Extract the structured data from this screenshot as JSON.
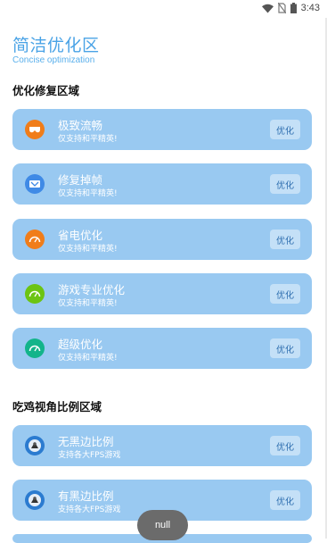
{
  "status_bar": {
    "time": "3:43"
  },
  "header": {
    "title": "简洁优化区",
    "subtitle": "Concise optimization"
  },
  "section1": {
    "title": "优化修复区域",
    "items": [
      {
        "title": "极致流畅",
        "desc": "仅支持和平精英!",
        "button": "优化",
        "icon": "glasses-icon",
        "icon_color": "#f07d1a"
      },
      {
        "title": "修复掉帧",
        "desc": "仅支持和平精英!",
        "button": "优化",
        "icon": "card-icon",
        "icon_color": "#3f8ae6"
      },
      {
        "title": "省电优化",
        "desc": "仅支持和平精英!",
        "button": "优化",
        "icon": "gauge-icon",
        "icon_color": "#f07d1a"
      },
      {
        "title": "游戏专业优化",
        "desc": "仅支持和平精英!",
        "button": "优化",
        "icon": "gauge-icon",
        "icon_color": "#6cc413"
      },
      {
        "title": "超级优化",
        "desc": "仅支持和平精英!",
        "button": "优化",
        "icon": "gauge-icon",
        "icon_color": "#13b48a"
      }
    ]
  },
  "section2": {
    "title": "吃鸡视角比例区域",
    "items": [
      {
        "title": "无黑边比例",
        "desc": "支持各大FPS游戏",
        "button": "优化",
        "icon": "soldier-icon",
        "icon_color": "#2b7bd0"
      },
      {
        "title": "有黑边比例",
        "desc": "支持各大FPS游戏",
        "button": "优化",
        "icon": "soldier-icon",
        "icon_color": "#2b7bd0"
      }
    ]
  },
  "toast": {
    "text": "null"
  }
}
